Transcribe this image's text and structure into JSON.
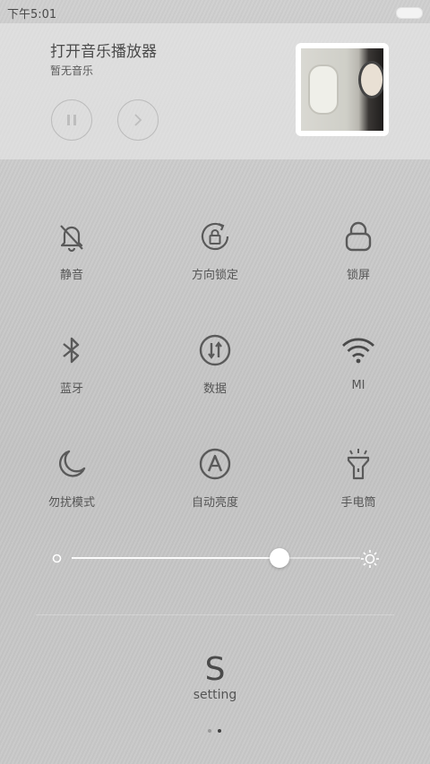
{
  "status_bar": {
    "time": "下午5:01",
    "battery_icon": "battery-icon"
  },
  "music": {
    "title": "打开音乐播放器",
    "subtitle": "暂无音乐",
    "pause_icon": "pause-icon",
    "next_icon": "next-icon",
    "album_art": "album-art"
  },
  "toggles": [
    {
      "label": "静音",
      "icon": "bell-off-icon"
    },
    {
      "label": "方向锁定",
      "icon": "rotation-lock-icon"
    },
    {
      "label": "锁屏",
      "icon": "lock-icon"
    },
    {
      "label": "蓝牙",
      "icon": "bluetooth-icon"
    },
    {
      "label": "数据",
      "icon": "data-icon"
    },
    {
      "label": "MI",
      "icon": "wifi-icon"
    },
    {
      "label": "勿扰模式",
      "icon": "moon-icon"
    },
    {
      "label": "自动亮度",
      "icon": "auto-brightness-icon"
    },
    {
      "label": "手电筒",
      "icon": "flashlight-icon"
    }
  ],
  "brightness": {
    "level": 0.72,
    "low_icon": "brightness-low-icon",
    "high_icon": "sun-icon"
  },
  "setting": {
    "glyph": "S",
    "label": "setting"
  },
  "page_indicator": {
    "count": 2,
    "active": 1
  },
  "colors": {
    "icon": "#5a5a5a",
    "text": "#555555",
    "accent_white": "#ffffff"
  }
}
